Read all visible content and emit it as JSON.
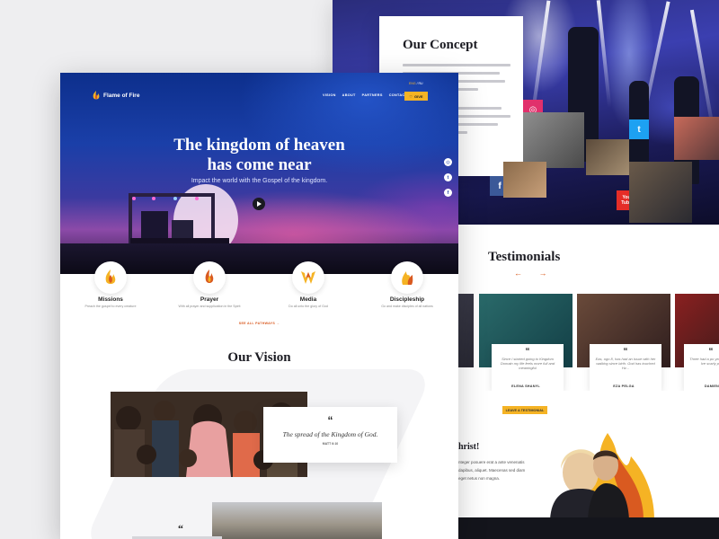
{
  "brand": {
    "name": "Flame of Fire",
    "accent": "#f5b324",
    "orange": "#d95a20"
  },
  "nav": {
    "items": [
      "VISION",
      "ABOUT",
      "PARTNERS",
      "CONTACT"
    ],
    "give_label": "GIVE",
    "lang_active": "ENG",
    "lang_other": "RU"
  },
  "hero": {
    "title_line1": "The kingdom of heaven",
    "title_line2": "has come near",
    "subtitle": "Impact the world with the Gospel of the kingdom."
  },
  "social": {
    "instagram": "◎",
    "twitter": "t",
    "facebook": "f",
    "youtube_label": "You Tube"
  },
  "ministries": [
    {
      "title": "Missions",
      "desc": "Preach the gospel to every creature"
    },
    {
      "title": "Prayer",
      "desc": "With all prayer and supplication in the Spirit"
    },
    {
      "title": "Media",
      "desc": "Do all unto the glory of God"
    },
    {
      "title": "Discipleship",
      "desc": "Go and make disciples of all nations"
    }
  ],
  "see_all": "SEE ALL PATHWAYS →",
  "vision": {
    "title": "Our Vision",
    "quote": "The spread of the Kingdom of God.",
    "ref": "MATT 6:10",
    "second_quote_mark": "“"
  },
  "concept": {
    "title": "Our Concept"
  },
  "testimonials": {
    "title": "Testimonials",
    "arrows": "← →",
    "items": [
      {
        "text": "Since I started going to Kingdom Domain my life feels more full and meaningful",
        "name": "ELENA SHANYL"
      },
      {
        "text": "Eas, ogo 8, has had an issue with her walking since birth. God has touched Hz...",
        "name": "EZA PELGA"
      },
      {
        "text": "Three had a po years, now Ive scarly po",
        "name": "DAMIEN"
      }
    ],
    "leave_label": "LEAVE A TESTIMONIAL"
  },
  "christ": {
    "title": "hrist!",
    "text": "nteger posuere erat a ante venenatis dapibus, aliquet. Maecenas sed diam eget netus non magna."
  }
}
